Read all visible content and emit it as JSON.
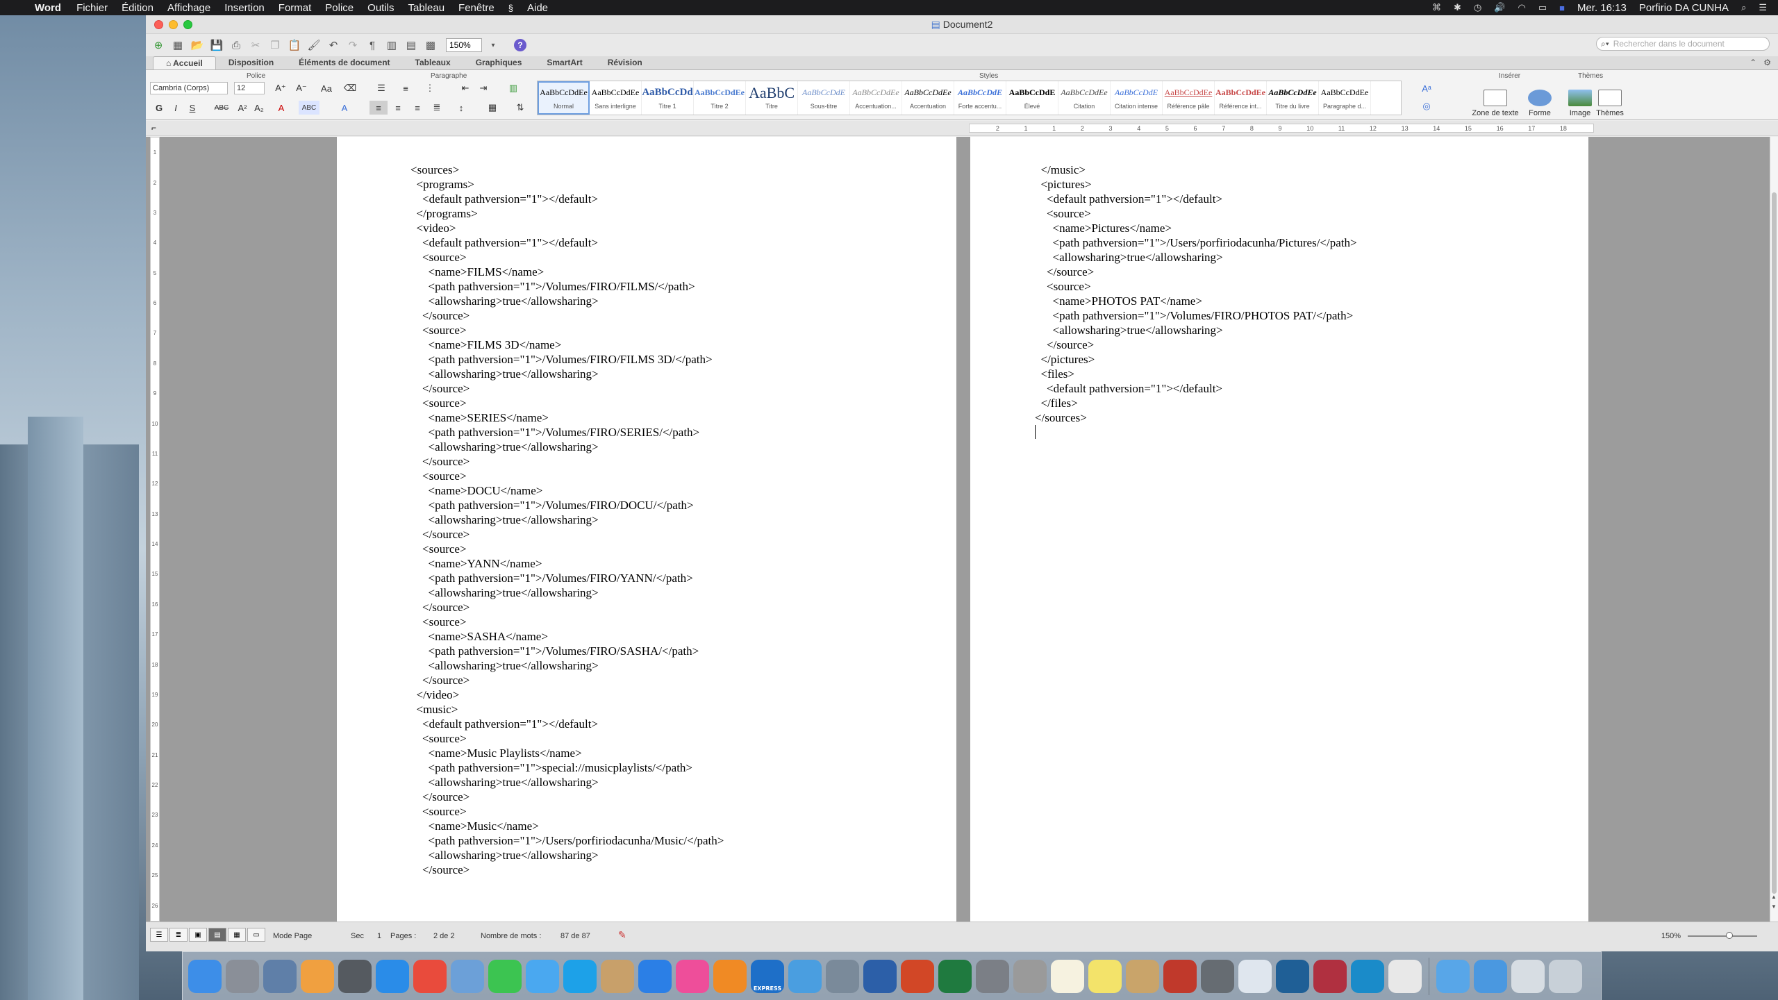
{
  "menubar": {
    "app_name": "Word",
    "menus": [
      "Fichier",
      "Édition",
      "Affichage",
      "Insertion",
      "Format",
      "Police",
      "Outils",
      "Tableau",
      "Fenêtre",
      "Aide"
    ],
    "clock": "Mer. 16:13",
    "user": "Porfirio DA CUNHA"
  },
  "window": {
    "title": "Document2"
  },
  "toolbar": {
    "zoom": "150%",
    "search_placeholder": "Rechercher dans le document"
  },
  "ribbon": {
    "tabs": [
      "Accueil",
      "Disposition",
      "Éléments de document",
      "Tableaux",
      "Graphiques",
      "SmartArt",
      "Révision"
    ],
    "groups": {
      "police": "Police",
      "paragraphe": "Paragraphe",
      "styles": "Styles",
      "inserer": "Insérer",
      "themes": "Thèmes"
    },
    "font_name": "Cambria (Corps)",
    "font_size": "12",
    "styles": [
      {
        "preview": "AaBbCcDdEe",
        "name": "Normal"
      },
      {
        "preview": "AaBbCcDdEe",
        "name": "Sans interligne"
      },
      {
        "preview": "AaBbCcDd",
        "name": "Titre 1"
      },
      {
        "preview": "AaBbCcDdEe",
        "name": "Titre 2"
      },
      {
        "preview": "AaBbC",
        "name": "Titre"
      },
      {
        "preview": "AaBbCcDdE",
        "name": "Sous-titre"
      },
      {
        "preview": "AaBbCcDdEe",
        "name": "Accentuation..."
      },
      {
        "preview": "AaBbCcDdEe",
        "name": "Accentuation"
      },
      {
        "preview": "AaBbCcDdE",
        "name": "Forte accentu..."
      },
      {
        "preview": "AaBbCcDdE",
        "name": "Élevé"
      },
      {
        "preview": "AaBbCcDdEe",
        "name": "Citation"
      },
      {
        "preview": "AaBbCcDdE",
        "name": "Citation intense"
      },
      {
        "preview": "AaBbCcDdEe",
        "name": "Référence pâle"
      },
      {
        "preview": "AaBbCcDdEe",
        "name": "Référence int..."
      },
      {
        "preview": "AaBbCcDdEe",
        "name": "Titre du livre"
      },
      {
        "preview": "AaBbCcDdEe",
        "name": "Paragraphe d..."
      }
    ],
    "insert": [
      "Zone de texte",
      "Forme",
      "Image"
    ],
    "themes_btn": "Thèmes"
  },
  "ruler_numbers": [
    "2",
    "1",
    "1",
    "2",
    "3",
    "4",
    "5",
    "6",
    "7",
    "8",
    "9",
    "10",
    "11",
    "12",
    "13",
    "14",
    "15",
    "16",
    "17",
    "18"
  ],
  "vruler_numbers": [
    "1",
    "2",
    "3",
    "4",
    "5",
    "6",
    "7",
    "8",
    "9",
    "10",
    "11",
    "12",
    "13",
    "14",
    "15",
    "16",
    "17",
    "18",
    "19",
    "20",
    "21",
    "22",
    "23",
    "24",
    "25",
    "26"
  ],
  "page1_lines": [
    "<sources>",
    "  <programs>",
    "    <default pathversion=\"1\"></default>",
    "  </programs>",
    "  <video>",
    "    <default pathversion=\"1\"></default>",
    "    <source>",
    "      <name>FILMS</name>",
    "      <path pathversion=\"1\">/Volumes/FIRO/FILMS/</path>",
    "      <allowsharing>true</allowsharing>",
    "    </source>",
    "    <source>",
    "      <name>FILMS 3D</name>",
    "      <path pathversion=\"1\">/Volumes/FIRO/FILMS 3D/</path>",
    "      <allowsharing>true</allowsharing>",
    "    </source>",
    "    <source>",
    "      <name>SERIES</name>",
    "      <path pathversion=\"1\">/Volumes/FIRO/SERIES/</path>",
    "      <allowsharing>true</allowsharing>",
    "    </source>",
    "    <source>",
    "      <name>DOCU</name>",
    "      <path pathversion=\"1\">/Volumes/FIRO/DOCU/</path>",
    "      <allowsharing>true</allowsharing>",
    "    </source>",
    "    <source>",
    "      <name>YANN</name>",
    "      <path pathversion=\"1\">/Volumes/FIRO/YANN/</path>",
    "      <allowsharing>true</allowsharing>",
    "    </source>",
    "    <source>",
    "      <name>SASHA</name>",
    "      <path pathversion=\"1\">/Volumes/FIRO/SASHA/</path>",
    "      <allowsharing>true</allowsharing>",
    "    </source>",
    "  </video>",
    "  <music>",
    "    <default pathversion=\"1\"></default>",
    "    <source>",
    "      <name>Music Playlists</name>",
    "      <path pathversion=\"1\">special://musicplaylists/</path>",
    "      <allowsharing>true</allowsharing>",
    "    </source>",
    "    <source>",
    "      <name>Music</name>",
    "      <path pathversion=\"1\">/Users/porfiriodacunha/Music/</path>",
    "      <allowsharing>true</allowsharing>",
    "    </source>"
  ],
  "page2_lines": [
    "  </music>",
    "  <pictures>",
    "    <default pathversion=\"1\"></default>",
    "    <source>",
    "      <name>Pictures</name>",
    "      <path pathversion=\"1\">/Users/porfiriodacunha/Pictures/</path>",
    "      <allowsharing>true</allowsharing>",
    "    </source>",
    "    <source>",
    "      <name>PHOTOS PAT</name>",
    "      <path pathversion=\"1\">/Volumes/FIRO/PHOTOS PAT/</path>",
    "      <allowsharing>true</allowsharing>",
    "    </source>",
    "  </pictures>",
    "  <files>",
    "    <default pathversion=\"1\"></default>",
    "  </files>",
    "</sources>"
  ],
  "status": {
    "mode": "Mode Page",
    "sec_label": "Sec",
    "sec_value": "1",
    "pages_label": "Pages :",
    "pages_value": "2 de 2",
    "words_label": "Nombre de mots :",
    "words_value": "87 de 87",
    "zoom": "150%"
  },
  "dock": {
    "apps": [
      {
        "name": "finder-icon",
        "color": "#3d8ee8"
      },
      {
        "name": "launchpad-icon",
        "color": "#8a8f98"
      },
      {
        "name": "preview-icon",
        "color": "#5f7fa8"
      },
      {
        "name": "photos-icon",
        "color": "#f0a040"
      },
      {
        "name": "screenshot-icon",
        "color": "#555a60"
      },
      {
        "name": "safari-icon",
        "color": "#2a8ce8"
      },
      {
        "name": "chrome-icon",
        "color": "#e94b3c"
      },
      {
        "name": "preview-photos-icon",
        "color": "#6ca0d8"
      },
      {
        "name": "facetime-icon",
        "color": "#3cc451"
      },
      {
        "name": "messages-icon",
        "color": "#4aa8f0"
      },
      {
        "name": "skype-icon",
        "color": "#1da1e8"
      },
      {
        "name": "contacts-icon",
        "color": "#c8a06a"
      },
      {
        "name": "app-store-icon",
        "color": "#2b7fe6"
      },
      {
        "name": "itunes-icon",
        "color": "#ee4e9a"
      },
      {
        "name": "ibooks-icon",
        "color": "#f08a24"
      },
      {
        "name": "express-icon",
        "color": "#1e6fc8"
      },
      {
        "name": "cloud-icon",
        "color": "#4a9ee0"
      },
      {
        "name": "printer-icon",
        "color": "#7a8a9a"
      },
      {
        "name": "word-icon",
        "color": "#2c5fa8"
      },
      {
        "name": "powerpoint-icon",
        "color": "#d24726"
      },
      {
        "name": "excel-icon",
        "color": "#1f7a3f"
      },
      {
        "name": "system-preferences-icon",
        "color": "#7b7f86"
      },
      {
        "name": "utility-icon",
        "color": "#9a9a9a"
      },
      {
        "name": "notes-icon",
        "color": "#f6f2e0"
      },
      {
        "name": "stickies-icon",
        "color": "#f3e36a"
      },
      {
        "name": "image-capture-icon",
        "color": "#c9a46a"
      },
      {
        "name": "filezilla-icon",
        "color": "#c0392b"
      },
      {
        "name": "trash-tool-icon",
        "color": "#666c72"
      },
      {
        "name": "document-icon",
        "color": "#dfe6ee"
      },
      {
        "name": "terminal-icon",
        "color": "#1f5f96"
      },
      {
        "name": "unknown-red-icon",
        "color": "#b03040"
      },
      {
        "name": "kodi-icon",
        "color": "#1a8bc9"
      },
      {
        "name": "textedit-icon",
        "color": "#e8e8e8"
      }
    ],
    "right": [
      {
        "name": "folder-icon",
        "color": "#58a6e8"
      },
      {
        "name": "applications-folder-icon",
        "color": "#4a98e0"
      },
      {
        "name": "downloads-stack-icon",
        "color": "#d7dde3"
      },
      {
        "name": "trash-icon",
        "color": "#c8d0d8"
      }
    ],
    "labels": {
      "express": "EXPRESS"
    }
  }
}
